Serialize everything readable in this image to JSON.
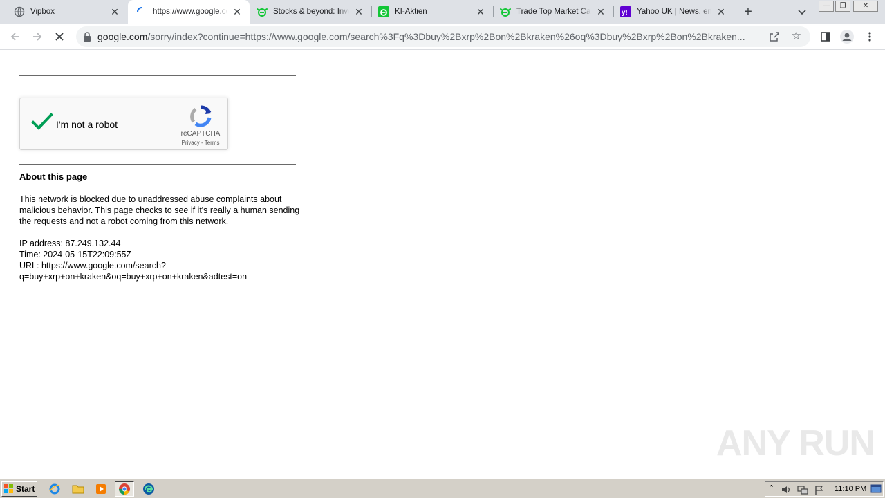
{
  "tabs": [
    {
      "title": "Vipbox",
      "icon": "globe-icon"
    },
    {
      "title": "https://www.google.com/sorry/index",
      "icon": "loading-spinner-icon",
      "active": true
    },
    {
      "title": "Stocks & beyond: Investing",
      "icon": "etoro-icon"
    },
    {
      "title": "KI-Aktien",
      "icon": "etoro-square-icon"
    },
    {
      "title": "Trade Top Market Cap Crypto",
      "icon": "etoro-icon"
    },
    {
      "title": "Yahoo UK | News, email and search",
      "icon": "yahoo-icon"
    }
  ],
  "address_bar": {
    "host": "google.com",
    "path": "/sorry/index?continue=https://www.google.com/search%3Fq%3Dbuy%2Bxrp%2Bon%2Bkraken%26oq%3Dbuy%2Bxrp%2Bon%2Bkraken..."
  },
  "captcha": {
    "label": "I'm not a robot",
    "brand": "reCAPTCHA",
    "privacy": "Privacy",
    "sep": " - ",
    "terms": "Terms",
    "checked": true
  },
  "about": {
    "heading": "About this page",
    "paragraph": "This network is blocked due to unaddressed abuse complaints about malicious behavior. This page checks to see if it's really a human sending the requests and not a robot coming from this network.",
    "ip_line": "IP address: 87.249.132.44",
    "time_line": "Time: 2024-05-15T22:09:55Z",
    "url_line_1": "URL: https://www.google.com/search?",
    "url_line_2": "q=buy+xrp+on+kraken&oq=buy+xrp+on+kraken&adtest=on"
  },
  "watermark": "ANY RUN",
  "taskbar": {
    "start_label": "Start",
    "clock": "11:10 PM"
  },
  "colors": {
    "tabbar_bg": "#dee1e6",
    "captcha_check": "#009e55",
    "etoro_green": "#13c636",
    "yahoo_purple": "#6001d2"
  }
}
